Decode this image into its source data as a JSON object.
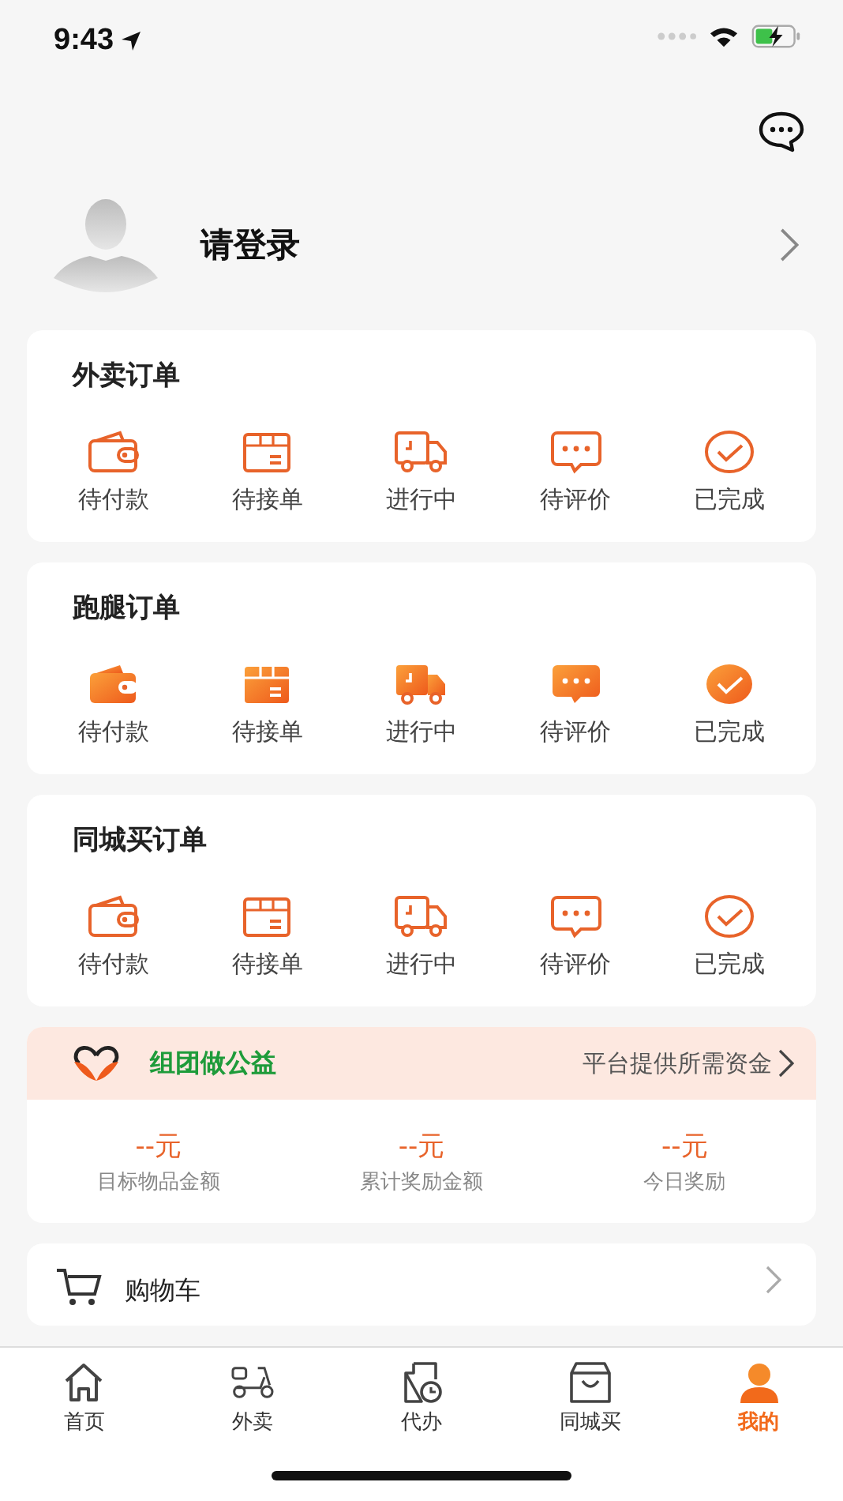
{
  "status_bar": {
    "time": "9:43"
  },
  "profile": {
    "name": "请登录"
  },
  "order_cards": [
    {
      "title": "外卖订单",
      "kind": "outline",
      "items": [
        {
          "kind": "wallet",
          "label": "待付款"
        },
        {
          "kind": "box",
          "label": "待接单"
        },
        {
          "kind": "truck",
          "label": "进行中"
        },
        {
          "kind": "comment",
          "label": "待评价"
        },
        {
          "kind": "check",
          "label": "已完成"
        }
      ]
    },
    {
      "title": "跑腿订单",
      "kind": "filled",
      "items": [
        {
          "kind": "wallet",
          "label": "待付款"
        },
        {
          "kind": "box",
          "label": "待接单"
        },
        {
          "kind": "truck",
          "label": "进行中"
        },
        {
          "kind": "comment",
          "label": "待评价"
        },
        {
          "kind": "check",
          "label": "已完成"
        }
      ]
    },
    {
      "title": "同城买订单",
      "kind": "outline",
      "items": [
        {
          "kind": "wallet",
          "label": "待付款"
        },
        {
          "kind": "box",
          "label": "待接单"
        },
        {
          "kind": "truck",
          "label": "进行中"
        },
        {
          "kind": "comment",
          "label": "待评价"
        },
        {
          "kind": "check",
          "label": "已完成"
        }
      ]
    }
  ],
  "charity": {
    "title": "组团做公益",
    "link": "平台提供所需资金",
    "stats": [
      {
        "value": "--元",
        "label": "目标物品金额"
      },
      {
        "value": "--元",
        "label": "累计奖励金额"
      },
      {
        "value": "--元",
        "label": "今日奖励"
      }
    ]
  },
  "menu_rows": [
    {
      "label": "购物车"
    }
  ],
  "tab_bar": [
    {
      "kind": "home",
      "label": "首页",
      "selected": false
    },
    {
      "kind": "scooter",
      "label": "外卖",
      "selected": false
    },
    {
      "kind": "errand",
      "label": "代办",
      "selected": false
    },
    {
      "kind": "bag",
      "label": "同城买",
      "selected": false
    },
    {
      "kind": "person",
      "label": "我的",
      "selected": true
    }
  ]
}
